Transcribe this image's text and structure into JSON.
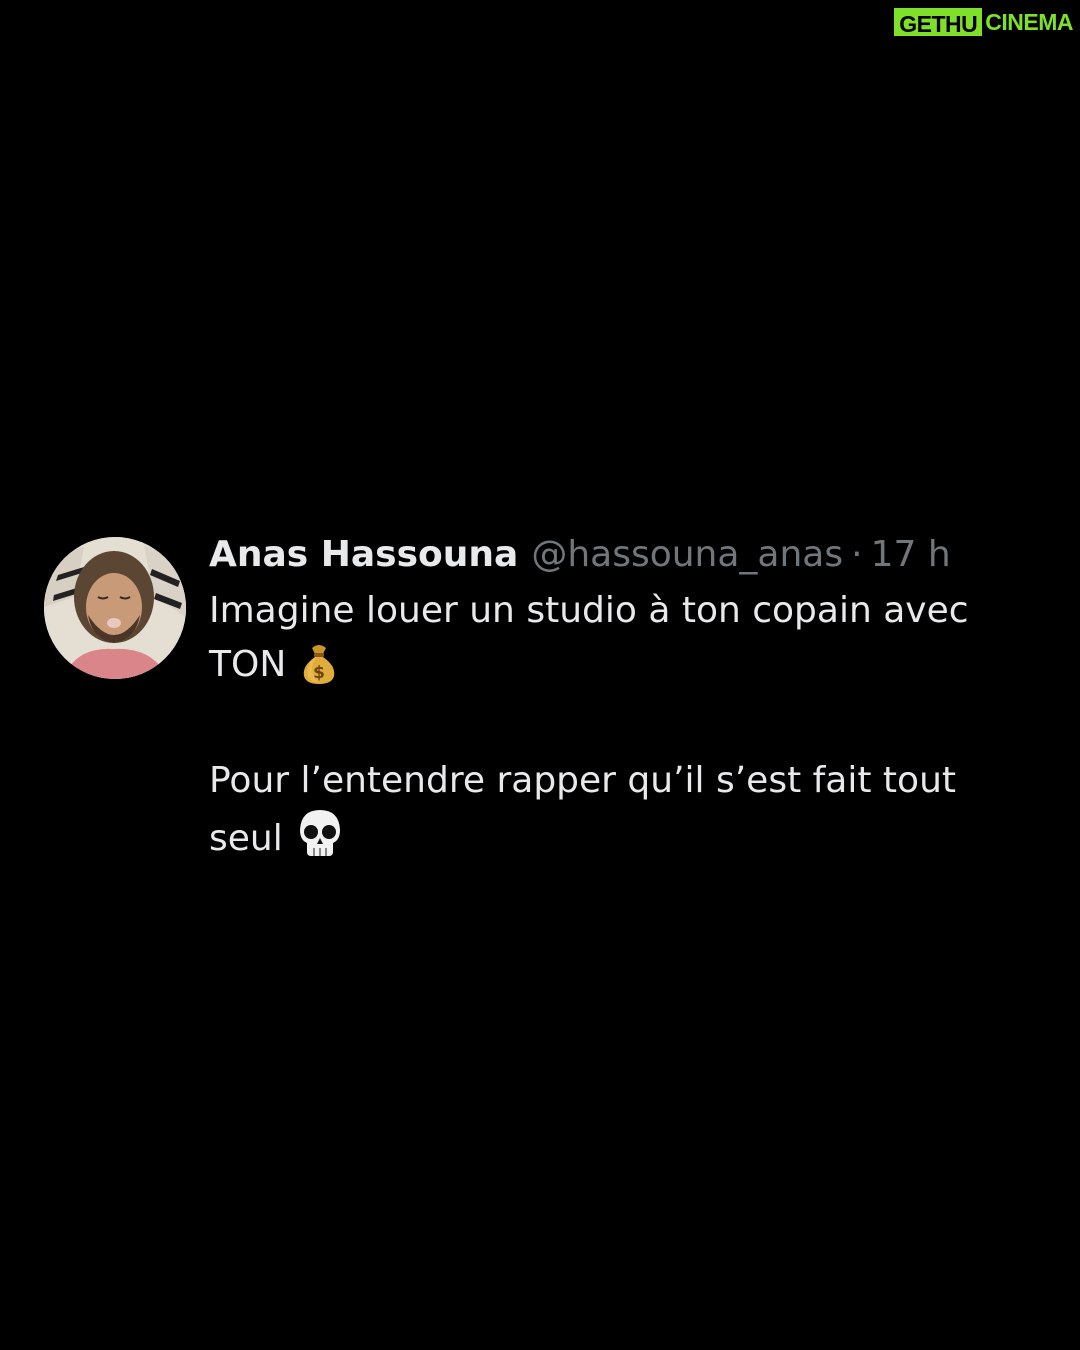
{
  "watermark": {
    "part1": "GETHU",
    "part2": "CINEMA",
    "accent_color": "#7fe02a"
  },
  "tweet": {
    "display_name": "Anas Hassouna",
    "handle": "@hassouna_anas",
    "separator": "·",
    "time": "17 h",
    "lines": [
      {
        "text": "Imagine louer un studio à ton copain avec"
      },
      {
        "text": "TON",
        "emoji": "money-bag-icon"
      },
      {
        "text": ""
      },
      {
        "text": "Pour l’entendre rapper qu’il s’est fait tout"
      },
      {
        "text": "seul",
        "emoji": "skull-icon"
      }
    ],
    "colors": {
      "background": "#000000",
      "primary_text": "#e7e9ea",
      "secondary_text": "#71767b"
    }
  }
}
